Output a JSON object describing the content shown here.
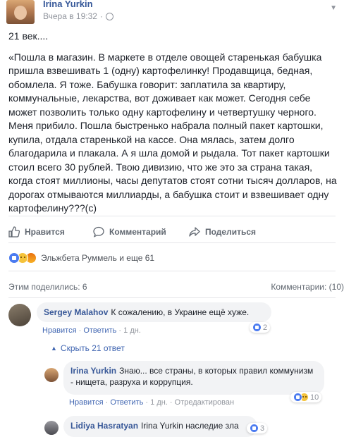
{
  "post": {
    "author": "Irina Yurkin",
    "time": "Вчера в 19:32",
    "privacy_icon": "globe-icon",
    "menu_icon": "chevron-down-icon",
    "intro": "21 век....",
    "body": "«Пошла в магазин. В маркете в отделе овощей старенькая бабушка пришла взвешивать 1 (одну) картофелинку! Продавщица, бедная, обомлела. Я тоже. Бабушка говорит: заплатила за квартиру, коммунальные, лекарства, вот доживает как может. Сегодня себе может позволить только одну картофелину и четвертушку черного. Меня прибило. Пошла быстренько набрала полный пакет картошки, купила, отдала старенькой на кассе. Она мялась, затем долго благодарила и плакала. А я шла домой и рыдала. Тот пакет картошки стоил всего 30 рублей. Твою дивизию, что же это за страна такая, когда стоят миллионы, часы депутатов стоят сотни тысяч долларов, на дорогах отмываются миллиарды, а бабушка стоит и взвешивает одну картофелину???(с)"
  },
  "actions": {
    "like": "Нравится",
    "comment": "Комментарий",
    "share": "Поделиться"
  },
  "reactions": {
    "names": "Эльжбета Руммель и еще 61",
    "types": [
      "like",
      "sad",
      "angry"
    ]
  },
  "stats": {
    "shares": "Этим поделились: 6",
    "comments": "Комментарии: (10)"
  },
  "comments": [
    {
      "author": "Sergey Malahov",
      "text": "К сожалению, в Украине ещё хуже.",
      "like": "Нравится",
      "reply": "Ответить",
      "time": "1 дн.",
      "reaction_count": "2",
      "hide_replies": "Скрыть 21 ответ"
    },
    {
      "author": "Irina Yurkin",
      "text": "Знаю... все страны, в которых правил коммунизм - нищета, разруха и коррупция.",
      "like": "Нравится",
      "reply": "Ответить",
      "time": "1 дн.",
      "edited": "Отредактирован",
      "reaction_count": "10"
    },
    {
      "author": "Lidiya Hasratyan",
      "text": "Irina Yurkin наследие зла",
      "reaction_count": "3"
    }
  ],
  "colors": {
    "link": "#365899",
    "meta": "#90949c",
    "bubble": "#f2f3f5",
    "like_blue": "#4b7bf0"
  }
}
